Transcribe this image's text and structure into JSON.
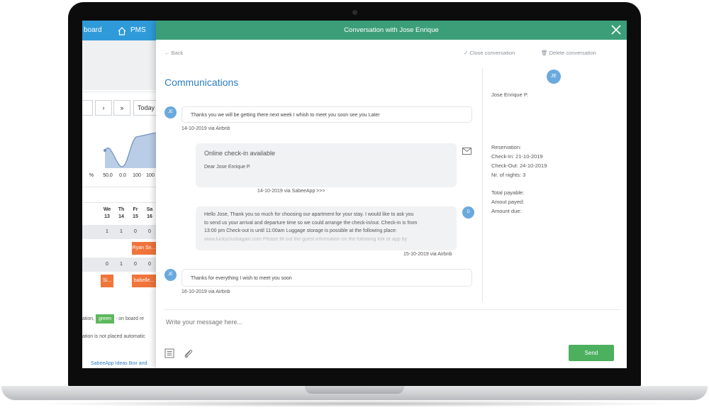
{
  "background_app": {
    "tabs": [
      {
        "label": "board"
      },
      {
        "label": "PMS"
      }
    ],
    "controls": [
      {
        "label": "›"
      },
      {
        "label": "»"
      },
      {
        "label": "Today"
      }
    ],
    "chart_row": {
      "unit": "%",
      "values": [
        "50.0",
        "0.0",
        "100",
        "100"
      ]
    },
    "day_headers": [
      {
        "day": "We",
        "num": "13"
      },
      {
        "day": "Th",
        "num": "14"
      },
      {
        "day": "Fr",
        "num": "15"
      },
      {
        "day": "Sa",
        "num": "16"
      }
    ],
    "row1": [
      "1",
      "1",
      "0",
      "0"
    ],
    "booking1": "Ryan Sn...",
    "row3": [
      "0",
      "1",
      "0",
      "0"
    ],
    "booking2": "Si...",
    "booking3": "babelle...",
    "legend_prefix": "ation,",
    "legend_badge": "green",
    "legend_suffix": "- on board re",
    "legend_line2": "ation is not placed automatic",
    "footer_link": "SabeeApp Ideas Box and",
    "colors": {
      "topbar": "#2f9ad9",
      "booking": "#f0753a",
      "badge": "#5cb85c"
    }
  },
  "modal": {
    "title": "Conversation with Jose Enrique",
    "back_label": "Back",
    "close_conversation_label": "Close conversation",
    "delete_conversation_label": "Delete conversation",
    "section_title": "Communications",
    "colors": {
      "header": "#3c9e78",
      "accent": "#2f7fc1",
      "send": "#4cb05f"
    },
    "messages": [
      {
        "avatar": "JE",
        "text": "Thanks you we will be getting there next week I whish to meet you soon see you Later",
        "meta": "14-10-2019 via Airbnb"
      },
      {
        "title": "Online check-in available",
        "text": "Dear Jose Enrique P.",
        "meta": "14-10-2019 via SabeeApp >>>"
      },
      {
        "avatar": "D",
        "lines": [
          "Hello Jose, Thank you so much for choosing our apartment for your stay. I would like to ask you",
          "to send us your arrival and departure time so we could arrange the check-in/out. Check-in is from",
          "13:00 pm Check-out is until 11:00am Luggage storage is possible at the following place:",
          "www.luckycluckagain.com Please fill out the guest information on the following link or app by"
        ],
        "meta": "15-10-2019 via Airbnb"
      },
      {
        "avatar": "JE",
        "text": "Thanks for everything I wish to meet you soon",
        "meta": "16-10-2019 via Airbnb"
      }
    ],
    "sidebar": {
      "avatar": "JE",
      "guest_name": "Jose Enrique P.",
      "reservation_label": "Reservation:",
      "checkin": "Check-In: 21-10-2019",
      "checkout": "Check-Out: 24-10-2019",
      "nights": "Nr. of nights: 3",
      "total_payable": "Total payable:",
      "amount_payed": "Amout payed:",
      "amount_due": "Amount due:"
    },
    "composer_placeholder": "Write your message here...",
    "send_label": "Send"
  }
}
